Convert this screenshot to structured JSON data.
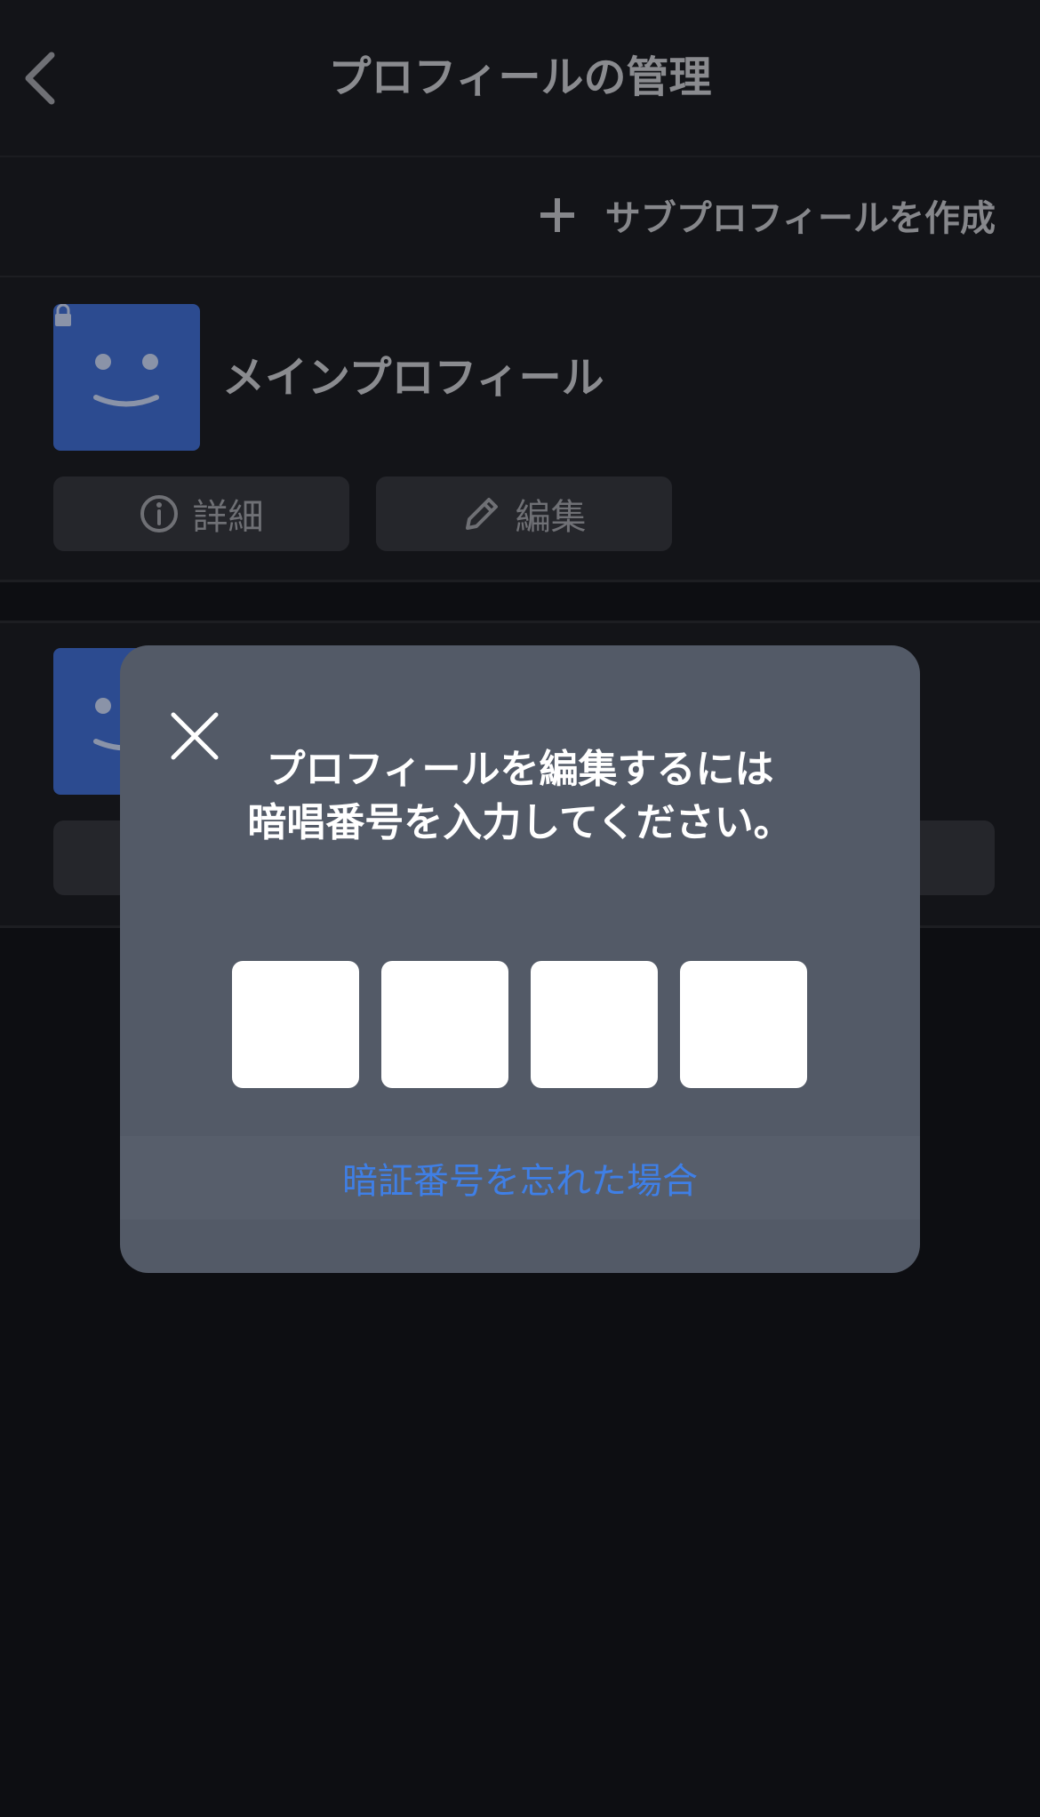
{
  "header": {
    "title": "プロフィールの管理"
  },
  "create_bar": {
    "label": "サブプロフィールを作成"
  },
  "profiles": [
    {
      "name": "メインプロフィール",
      "locked": true,
      "details_label": "詳細",
      "edit_label": "編集"
    },
    {
      "name": ""
    }
  ],
  "modal": {
    "line1": "プロフィールを編集するには",
    "line2": "暗唱番号を入力してください。",
    "pin_values": [
      "",
      "",
      "",
      ""
    ],
    "forgot_label": "暗証番号を忘れた場合"
  },
  "colors": {
    "background": "#0d0e12",
    "modal": "#535a67",
    "avatar": "#2c4b90",
    "link": "#3f7fe6"
  }
}
